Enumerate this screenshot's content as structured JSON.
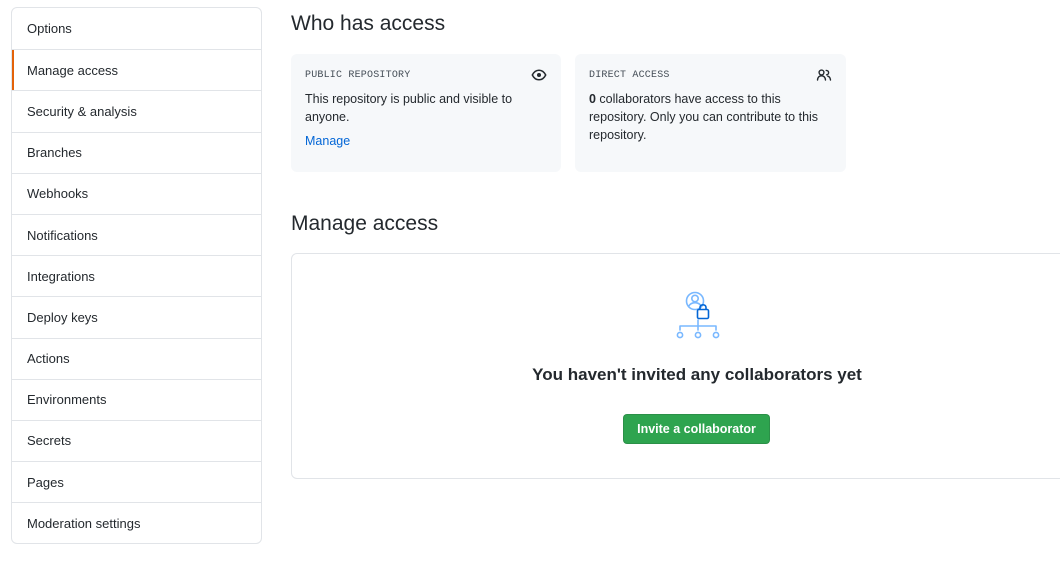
{
  "sidebar": {
    "items": [
      {
        "label": "Options"
      },
      {
        "label": "Manage access",
        "active": true
      },
      {
        "label": "Security & analysis"
      },
      {
        "label": "Branches"
      },
      {
        "label": "Webhooks"
      },
      {
        "label": "Notifications"
      },
      {
        "label": "Integrations"
      },
      {
        "label": "Deploy keys"
      },
      {
        "label": "Actions"
      },
      {
        "label": "Environments"
      },
      {
        "label": "Secrets"
      },
      {
        "label": "Pages"
      },
      {
        "label": "Moderation settings"
      }
    ]
  },
  "who_has_access": {
    "title": "Who has access",
    "public_box": {
      "label": "PUBLIC REPOSITORY",
      "text": "This repository is public and visible to anyone.",
      "link": "Manage",
      "icon": "eye-icon"
    },
    "direct_box": {
      "label": "DIRECT ACCESS",
      "count": "0",
      "text": " collaborators have access to this repository. Only you can contribute to this repository.",
      "icon": "people-icon"
    }
  },
  "manage_access": {
    "title": "Manage access",
    "empty_heading": "You haven't invited any collaborators yet",
    "invite_button": "Invite a collaborator",
    "icon": "collaborators-lock-icon"
  },
  "colors": {
    "link": "#0366d6",
    "button": "#2ea44f",
    "active_indicator": "#e36209",
    "icon_blue": "#79b8ff"
  }
}
